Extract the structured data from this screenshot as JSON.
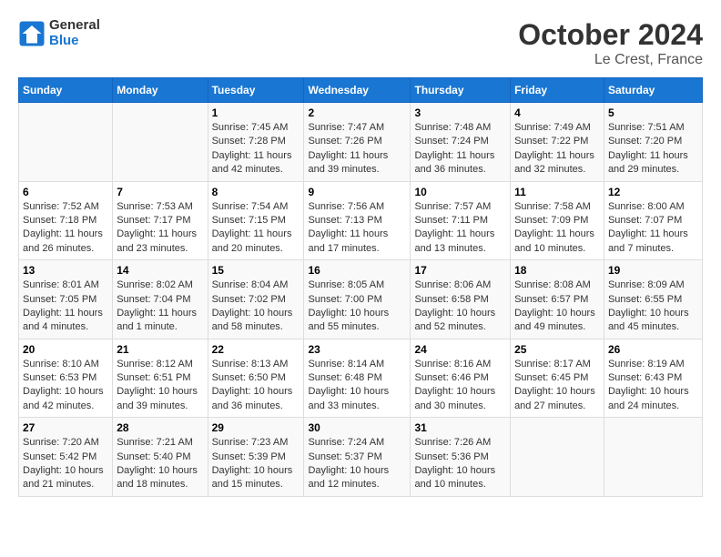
{
  "header": {
    "logo_line1": "General",
    "logo_line2": "Blue",
    "title": "October 2024",
    "subtitle": "Le Crest, France"
  },
  "days_of_week": [
    "Sunday",
    "Monday",
    "Tuesday",
    "Wednesday",
    "Thursday",
    "Friday",
    "Saturday"
  ],
  "weeks": [
    [
      {
        "day": "",
        "info": ""
      },
      {
        "day": "",
        "info": ""
      },
      {
        "day": "1",
        "info": "Sunrise: 7:45 AM\nSunset: 7:28 PM\nDaylight: 11 hours and 42 minutes."
      },
      {
        "day": "2",
        "info": "Sunrise: 7:47 AM\nSunset: 7:26 PM\nDaylight: 11 hours and 39 minutes."
      },
      {
        "day": "3",
        "info": "Sunrise: 7:48 AM\nSunset: 7:24 PM\nDaylight: 11 hours and 36 minutes."
      },
      {
        "day": "4",
        "info": "Sunrise: 7:49 AM\nSunset: 7:22 PM\nDaylight: 11 hours and 32 minutes."
      },
      {
        "day": "5",
        "info": "Sunrise: 7:51 AM\nSunset: 7:20 PM\nDaylight: 11 hours and 29 minutes."
      }
    ],
    [
      {
        "day": "6",
        "info": "Sunrise: 7:52 AM\nSunset: 7:18 PM\nDaylight: 11 hours and 26 minutes."
      },
      {
        "day": "7",
        "info": "Sunrise: 7:53 AM\nSunset: 7:17 PM\nDaylight: 11 hours and 23 minutes."
      },
      {
        "day": "8",
        "info": "Sunrise: 7:54 AM\nSunset: 7:15 PM\nDaylight: 11 hours and 20 minutes."
      },
      {
        "day": "9",
        "info": "Sunrise: 7:56 AM\nSunset: 7:13 PM\nDaylight: 11 hours and 17 minutes."
      },
      {
        "day": "10",
        "info": "Sunrise: 7:57 AM\nSunset: 7:11 PM\nDaylight: 11 hours and 13 minutes."
      },
      {
        "day": "11",
        "info": "Sunrise: 7:58 AM\nSunset: 7:09 PM\nDaylight: 11 hours and 10 minutes."
      },
      {
        "day": "12",
        "info": "Sunrise: 8:00 AM\nSunset: 7:07 PM\nDaylight: 11 hours and 7 minutes."
      }
    ],
    [
      {
        "day": "13",
        "info": "Sunrise: 8:01 AM\nSunset: 7:05 PM\nDaylight: 11 hours and 4 minutes."
      },
      {
        "day": "14",
        "info": "Sunrise: 8:02 AM\nSunset: 7:04 PM\nDaylight: 11 hours and 1 minute."
      },
      {
        "day": "15",
        "info": "Sunrise: 8:04 AM\nSunset: 7:02 PM\nDaylight: 10 hours and 58 minutes."
      },
      {
        "day": "16",
        "info": "Sunrise: 8:05 AM\nSunset: 7:00 PM\nDaylight: 10 hours and 55 minutes."
      },
      {
        "day": "17",
        "info": "Sunrise: 8:06 AM\nSunset: 6:58 PM\nDaylight: 10 hours and 52 minutes."
      },
      {
        "day": "18",
        "info": "Sunrise: 8:08 AM\nSunset: 6:57 PM\nDaylight: 10 hours and 49 minutes."
      },
      {
        "day": "19",
        "info": "Sunrise: 8:09 AM\nSunset: 6:55 PM\nDaylight: 10 hours and 45 minutes."
      }
    ],
    [
      {
        "day": "20",
        "info": "Sunrise: 8:10 AM\nSunset: 6:53 PM\nDaylight: 10 hours and 42 minutes."
      },
      {
        "day": "21",
        "info": "Sunrise: 8:12 AM\nSunset: 6:51 PM\nDaylight: 10 hours and 39 minutes."
      },
      {
        "day": "22",
        "info": "Sunrise: 8:13 AM\nSunset: 6:50 PM\nDaylight: 10 hours and 36 minutes."
      },
      {
        "day": "23",
        "info": "Sunrise: 8:14 AM\nSunset: 6:48 PM\nDaylight: 10 hours and 33 minutes."
      },
      {
        "day": "24",
        "info": "Sunrise: 8:16 AM\nSunset: 6:46 PM\nDaylight: 10 hours and 30 minutes."
      },
      {
        "day": "25",
        "info": "Sunrise: 8:17 AM\nSunset: 6:45 PM\nDaylight: 10 hours and 27 minutes."
      },
      {
        "day": "26",
        "info": "Sunrise: 8:19 AM\nSunset: 6:43 PM\nDaylight: 10 hours and 24 minutes."
      }
    ],
    [
      {
        "day": "27",
        "info": "Sunrise: 7:20 AM\nSunset: 5:42 PM\nDaylight: 10 hours and 21 minutes."
      },
      {
        "day": "28",
        "info": "Sunrise: 7:21 AM\nSunset: 5:40 PM\nDaylight: 10 hours and 18 minutes."
      },
      {
        "day": "29",
        "info": "Sunrise: 7:23 AM\nSunset: 5:39 PM\nDaylight: 10 hours and 15 minutes."
      },
      {
        "day": "30",
        "info": "Sunrise: 7:24 AM\nSunset: 5:37 PM\nDaylight: 10 hours and 12 minutes."
      },
      {
        "day": "31",
        "info": "Sunrise: 7:26 AM\nSunset: 5:36 PM\nDaylight: 10 hours and 10 minutes."
      },
      {
        "day": "",
        "info": ""
      },
      {
        "day": "",
        "info": ""
      }
    ]
  ]
}
